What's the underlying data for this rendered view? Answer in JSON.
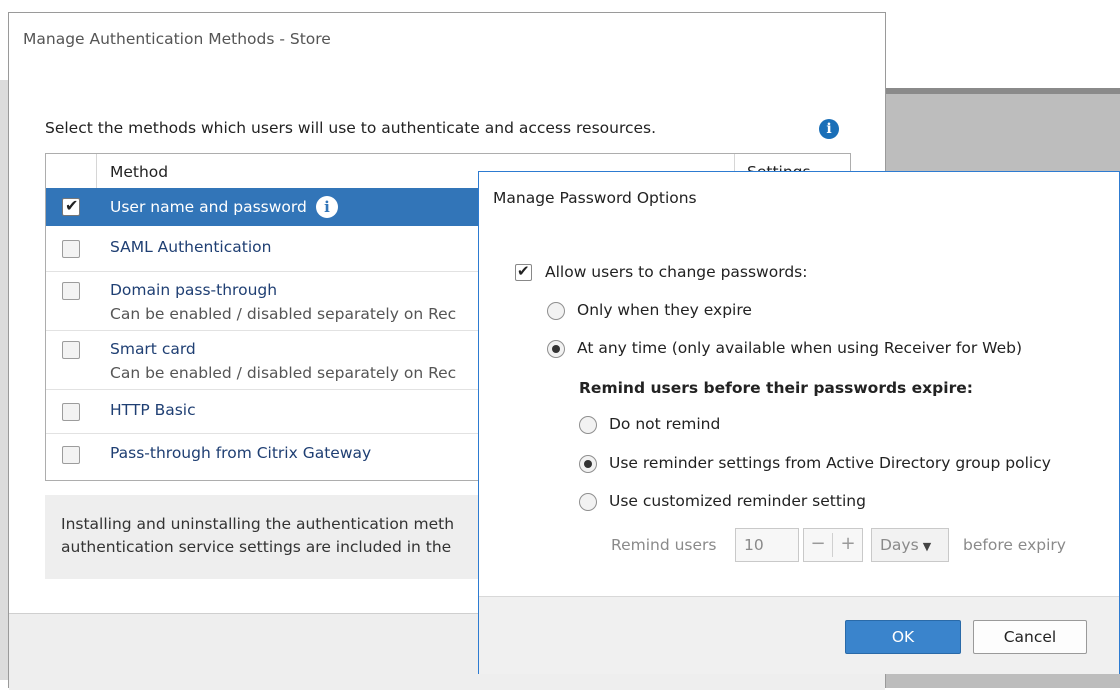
{
  "main_dialog": {
    "title": "Manage Authentication Methods - Store",
    "description": "Select the methods which users will use to authenticate and access resources.",
    "info_glyph": "i",
    "table": {
      "col_method": "Method",
      "col_settings": "Settings",
      "rows": [
        {
          "label": "User name and password",
          "checked": true,
          "selected": true
        },
        {
          "label": "SAML Authentication",
          "checked": false
        },
        {
          "label": "Domain pass-through",
          "sub": "Can be enabled / disabled separately on Rec",
          "checked": false
        },
        {
          "label": "Smart card",
          "sub": "Can be enabled / disabled separately on Rec",
          "checked": false
        },
        {
          "label": "HTTP Basic",
          "checked": false
        },
        {
          "label": "Pass-through from Citrix Gateway",
          "checked": false
        }
      ]
    },
    "notice_line1": "Installing and uninstalling the authentication meth",
    "notice_line2": "authentication service settings are included in the"
  },
  "password_dialog": {
    "title": "Manage Password Options",
    "allow_change_label": "Allow users to change passwords:",
    "allow_change_checked": true,
    "only_when_expire": "Only when they expire",
    "at_any_time": "At any time (only available when using Receiver for Web)",
    "remind_heading": "Remind users before their passwords expire:",
    "do_not_remind": "Do not remind",
    "use_ad_policy": "Use reminder settings from Active Directory group policy",
    "use_custom": "Use customized reminder setting",
    "remind_users_label": "Remind users",
    "remind_value": "10",
    "minus_glyph": "−",
    "plus_glyph": "+",
    "unit": "Days",
    "caret_glyph": "▼",
    "before_expiry": "before expiry",
    "ok_label": "OK",
    "cancel_label": "Cancel"
  },
  "icons": {
    "check_glyph": "✔",
    "info": "info-icon"
  },
  "colors": {
    "selection": "#3275b8",
    "accent": "#1a6fb8",
    "ok_button": "#3a84cc"
  }
}
